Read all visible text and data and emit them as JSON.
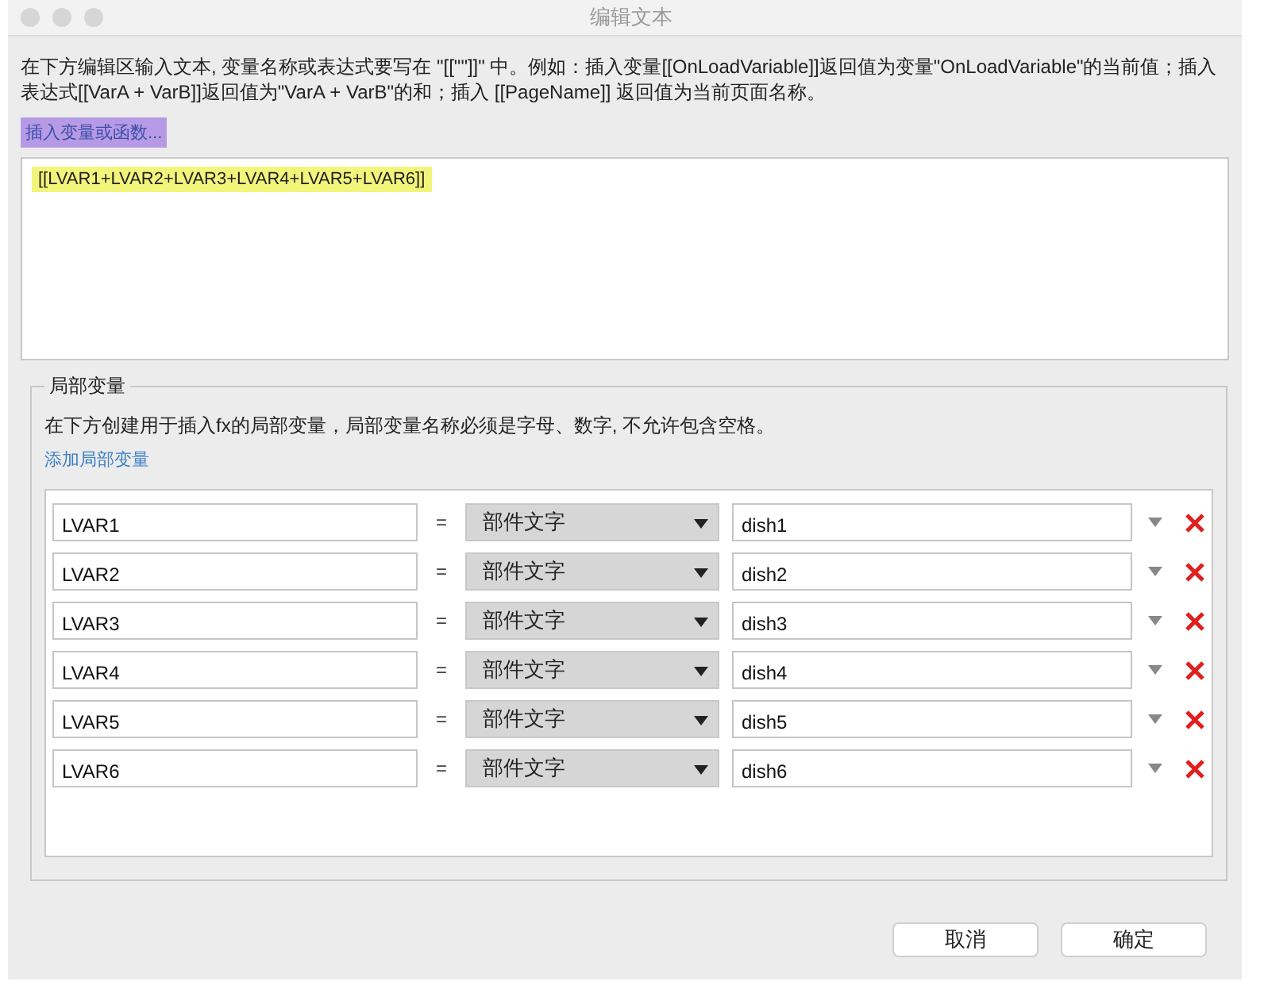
{
  "window": {
    "title": "编辑文本"
  },
  "description": "在下方编辑区输入文本, 变量名称或表达式要写在 \"[[\"\"]]\" 中。例如：插入变量[[OnLoadVariable]]返回值为变量\"OnLoadVariable\"的当前值；插入表达式[[VarA + VarB]]返回值为\"VarA + VarB\"的和；插入 [[PageName]] 返回值为当前页面名称。",
  "insert_link": "插入变量或函数...",
  "editor_text": "[[LVAR1+LVAR2+LVAR3+LVAR4+LVAR5+LVAR6]]",
  "local_vars": {
    "legend": "局部变量",
    "hint": "在下方创建用于插入fx的局部变量，局部变量名称必须是字母、数字, 不允许包含空格。",
    "add_link": "添加局部变量",
    "rows": [
      {
        "name": "LVAR1",
        "equals": "=",
        "type": "部件文字",
        "value": "dish1"
      },
      {
        "name": "LVAR2",
        "equals": "=",
        "type": "部件文字",
        "value": "dish2"
      },
      {
        "name": "LVAR3",
        "equals": "=",
        "type": "部件文字",
        "value": "dish3"
      },
      {
        "name": "LVAR4",
        "equals": "=",
        "type": "部件文字",
        "value": "dish4"
      },
      {
        "name": "LVAR5",
        "equals": "=",
        "type": "部件文字",
        "value": "dish5"
      },
      {
        "name": "LVAR6",
        "equals": "=",
        "type": "部件文字",
        "value": "dish6"
      }
    ]
  },
  "buttons": [
    "取消",
    "确定"
  ]
}
